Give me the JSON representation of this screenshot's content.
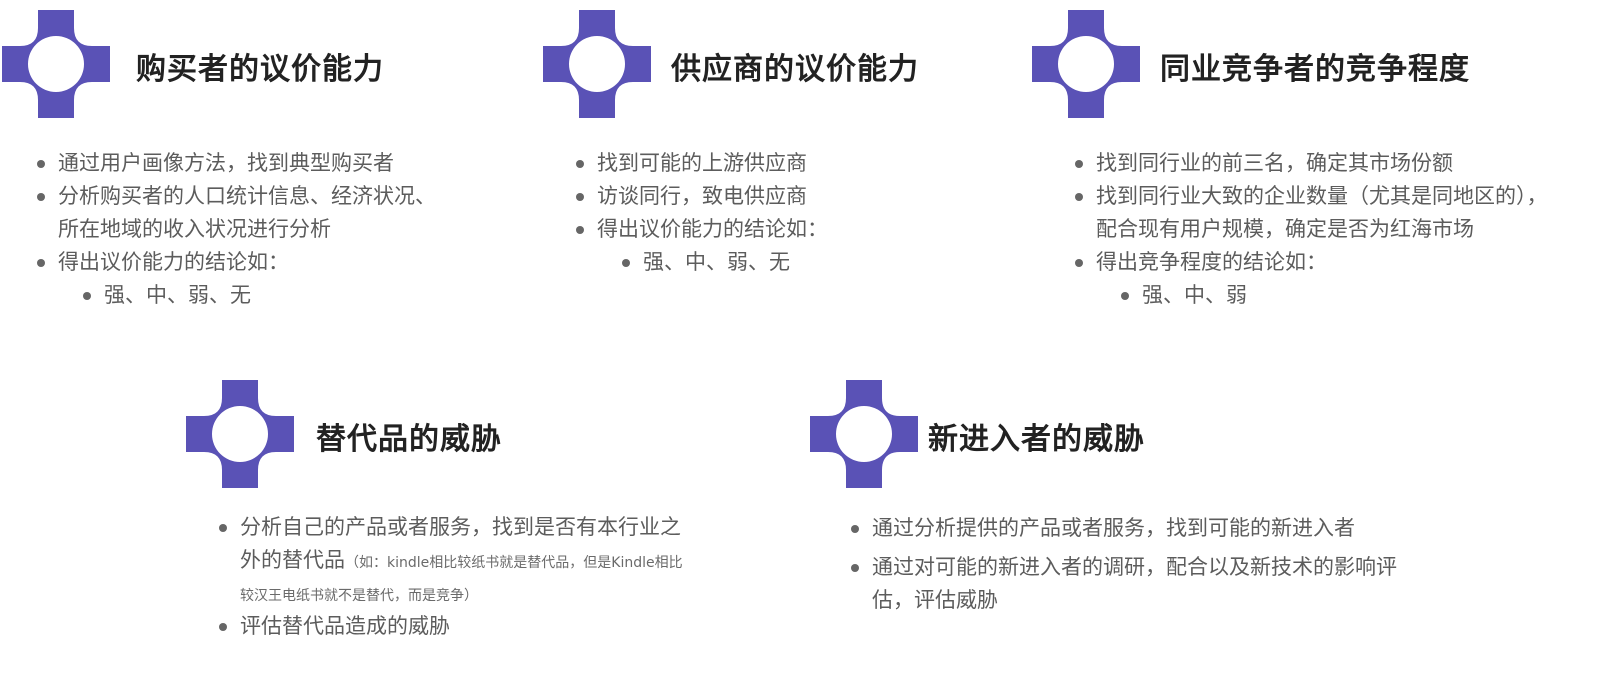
{
  "brand_color": "#5a52b6",
  "icon": "cross-shield-ring-icon",
  "blocks": {
    "buyer": {
      "title": "购买者的议价能力",
      "items": [
        "通过用户画像方法，找到典型购买者",
        "分析购买者的人口统计信息、经济状况、所在地域的收入状况进行分析",
        "得出议价能力的结论如："
      ],
      "sub": "强、中、弱、无"
    },
    "supplier": {
      "title": "供应商的议价能力",
      "items": [
        "找到可能的上游供应商",
        "访谈同行，致电供应商",
        "得出议价能力的结论如："
      ],
      "sub": "强、中、弱、无"
    },
    "competition": {
      "title": "同业竞争者的竞争程度",
      "items": [
        "找到同行业的前三名，确定其市场份额",
        "找到同行业大致的企业数量（尤其是同地区的），配合现有用户规模，确定是否为红海市场",
        "得出竞争程度的结论如："
      ],
      "sub": "强、中、弱"
    },
    "substitute": {
      "title": "替代品的威胁",
      "item1": "分析自己的产品或者服务，找到是否有本行业之外的替代品",
      "note": "（如：kindle相比较纸书就是替代品，但是Kindle相比较汉王电纸书就不是替代，而是竞争）",
      "item2": "评估替代品造成的威胁"
    },
    "new_entrant": {
      "title": "新进入者的威胁",
      "items": [
        "通过分析提供的产品或者服务，找到可能的新进入者",
        "通过对可能的新进入者的调研，配合以及新技术的影响评估，评估威胁"
      ]
    }
  }
}
